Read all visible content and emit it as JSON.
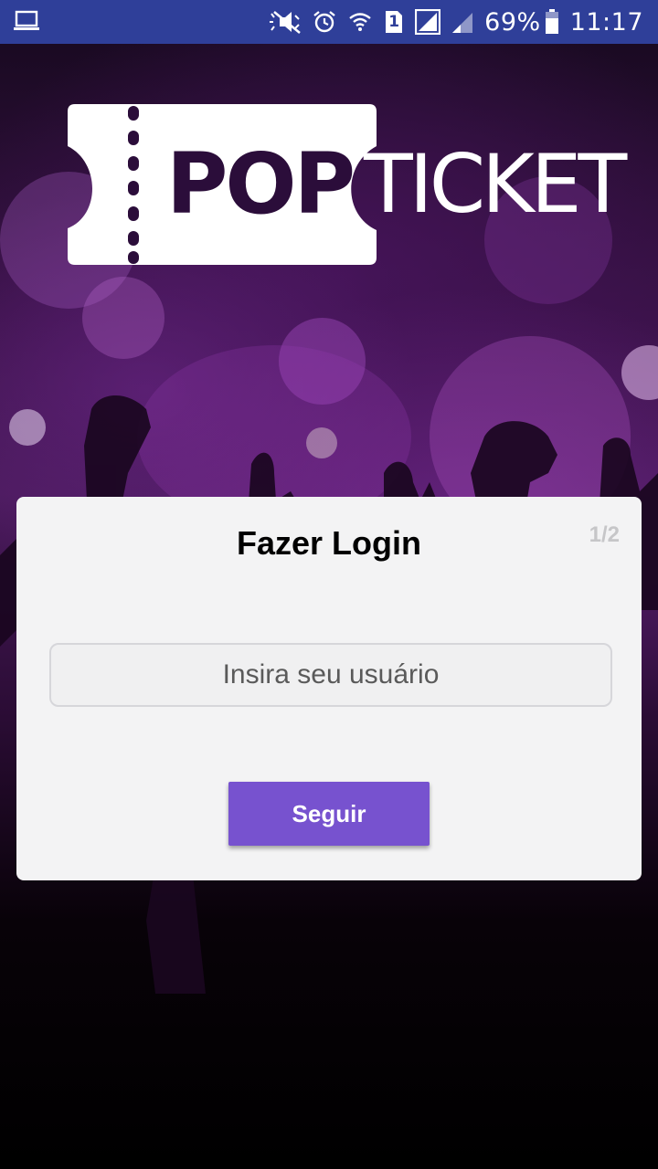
{
  "status_bar": {
    "battery": "69%",
    "time": "11:17",
    "sim_badge": "1",
    "icons": [
      "laptop-icon",
      "mute-icon",
      "alarm-icon",
      "wifi-icon",
      "sim-icon",
      "signal-icon",
      "signal-icon",
      "battery-icon"
    ]
  },
  "logo": {
    "pop": "POP",
    "ticket": "TICKET"
  },
  "login": {
    "title": "Fazer Login",
    "step": "1/2",
    "username_placeholder": "Insira seu usuário",
    "follow_label": "Seguir"
  },
  "colors": {
    "status_bar": "#2f3f99",
    "accent": "#7752cf",
    "card": "#f3f3f4"
  }
}
